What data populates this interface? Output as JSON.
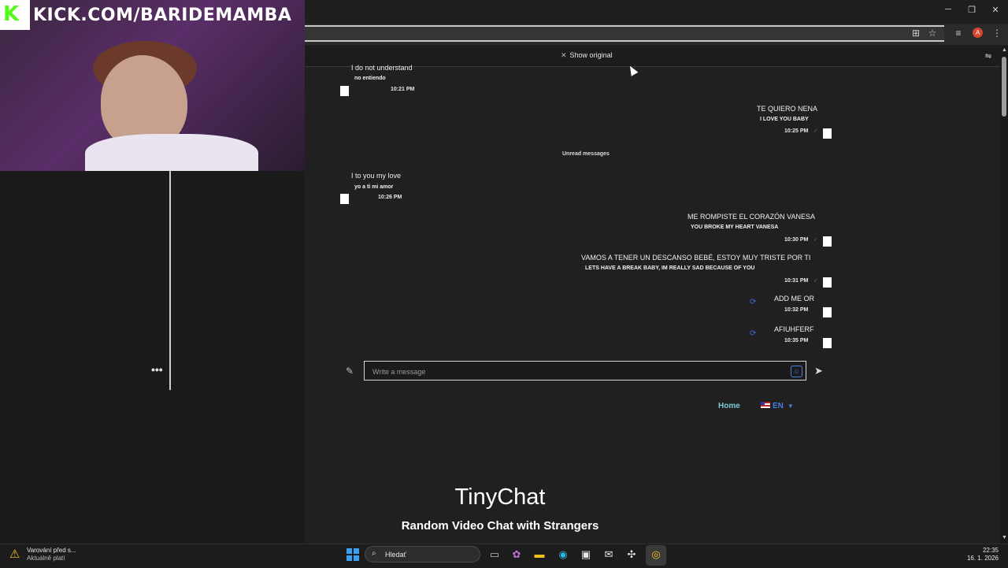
{
  "stream": {
    "url_overlay": "KICK.COM/BARIDEMAMBA",
    "kick_letter": "K"
  },
  "browser": {
    "minimize": "─",
    "restore": "❐",
    "close": "✕",
    "translate_bar": {
      "show_original": "Show original"
    }
  },
  "chat": {
    "messages": [
      {
        "side": "left",
        "text": "I do not understand",
        "translation": "no entiendo",
        "time": "10:21 PM"
      },
      {
        "side": "right",
        "text": "TE QUIERO NENA",
        "translation": "I LOVE YOU BABY",
        "time": "10:25 PM"
      },
      {
        "side": "left",
        "text": "I to you my love",
        "translation": "yo a ti mi amor",
        "time": "10:26 PM"
      },
      {
        "side": "right",
        "text": "ME ROMPISTE EL CORAZÓN VANESA",
        "translation": "YOU BROKE MY HEART VANESA",
        "time": "10:30 PM"
      },
      {
        "side": "right",
        "text": "VAMOS A TENER UN DESCANSO BEBÉ, ESTOY MUY TRISTE POR TI",
        "translation": "LETS HAVE A BREAK BABY, IM REALLY SAD BECAUSE OF YOU",
        "time": "10:31 PM"
      },
      {
        "side": "right",
        "text": "ADD ME OR",
        "time": "10:32 PM"
      },
      {
        "side": "right",
        "text": "AFIUHFERF",
        "time": "10:35 PM"
      }
    ],
    "unread_label": "Unread messages",
    "input_placeholder": "Write a message",
    "check_mark": "✓"
  },
  "site": {
    "logo_text": "tinychat",
    "nav": {
      "home": "Home",
      "language": "EN"
    },
    "hero": {
      "title": "TinyChat",
      "subtitle": "Random Video Chat with Strangers"
    }
  },
  "left_panel": {
    "more_label": "•••"
  },
  "taskbar": {
    "weather_line1": "Varování před s...",
    "weather_line2": "Aktuálně platí",
    "search_text": "Hledať",
    "time": "22:35",
    "date": "16. 1. 2026"
  },
  "colors": {
    "accent_blue": "#4a7ce0",
    "home_link": "#7ac8d8",
    "kick_green": "#53fc18"
  },
  "icons": {
    "attach": "paperclip-icon",
    "send": "send-icon",
    "emoji": "emoji-icon",
    "sync": "sync-icon",
    "translate": "translate-icon",
    "star": "star-icon"
  }
}
